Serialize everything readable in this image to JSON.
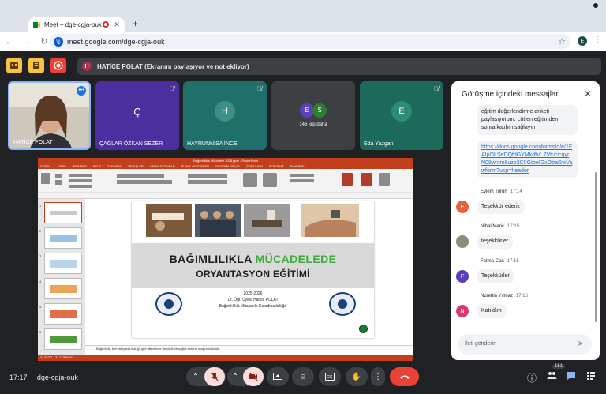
{
  "browser": {
    "tab_title": "Meet – dge-cgja-ouk",
    "url": "meet.google.com/dge-cgja-ouk",
    "profile_initial": "E"
  },
  "banner": {
    "initial": "H",
    "text": "HATİCE POLAT (Ekranını paylaşıyor ve not ekliyor)"
  },
  "tiles": [
    {
      "name": "HATİCE POLAT",
      "type": "video"
    },
    {
      "name": "ÇAĞLAR ÖZKAN SEZER",
      "initial": "Ç",
      "color": "#4a2f9f"
    },
    {
      "name": "HAYRUNNİSA İNCE",
      "initial": "H",
      "color": "#1f6f6a"
    },
    {
      "name": "",
      "count_text": "146 kişi daha",
      "initials": [
        "E",
        "S"
      ]
    },
    {
      "name": "Eda Yazgan",
      "initial": "E",
      "color": "#1c6b5a"
    }
  ],
  "presentation": {
    "window_title": "Bağımlılıkla Mücadele 2025.pptx - PowerPoint",
    "menu": [
      "DOSYA",
      "GİRİŞ",
      "WPS PDF",
      "EKLE",
      "TASARIM",
      "GEÇİŞLER",
      "ANİMASYONLAR",
      "SLAYT GÖSTERİSİ",
      "GÖZDEN GEÇİR",
      "GÖRÜNÜM",
      "ACROBAT",
      "Foxit PDF"
    ],
    "slide_title_1": "BAĞIMLILIKLA",
    "slide_title_1_green": "MÜCADELEDE",
    "slide_title_2": "ORYANTASYON EĞİTİMİ",
    "year": "2025-2026",
    "presenter": "Dr. Öğr. Üyesi Hatice POLAT",
    "office": "Bağımlılıkla Mücadele Koordinatörlüğü",
    "notes": "Bağımlılık, tüm dünyada olduğu gibi ülkemizde de ciddi bir sağlık sorunu oluşturmaktadır.",
    "status": "SLAYT 1 / 34   TÜRKÇE"
  },
  "chat": {
    "title": "Görüşme içindeki messajlar",
    "first_message": "eğitim değerlendirme anketi paylaşıyorum. Lütfen eğitimden sonra katılım sağlayın",
    "link": "https://docs.google.com/forms/d/e/1FAIpQLSeDQfdGYMkdfV_7VtucicqyrN08wmm8uzp3C0GtoeIGxObaGwVawform?usp=header",
    "messages": [
      {
        "sender": "Eylem Turun",
        "time": "17:14",
        "text": "Teşekkür ederiz",
        "initial": "E",
        "color": "#e8613a"
      },
      {
        "sender": "Nihal Meriç",
        "time": "17:15",
        "text": "teşekkürler",
        "initial": "",
        "color": "#8d8d7a"
      },
      {
        "sender": "Fatma Can",
        "time": "17:15",
        "text": "Teşekkürler",
        "initial": "F",
        "color": "#5a3fc0"
      },
      {
        "sender": "Nurettin Yılmaz",
        "time": "17:16",
        "text": "Katıldım",
        "initial": "N",
        "color": "#d93a6b"
      }
    ],
    "input_placeholder": "İleti gönderin"
  },
  "bottom": {
    "time": "17:17",
    "meeting_code": "dge-cgja-ouk",
    "participants_badge": "151"
  }
}
